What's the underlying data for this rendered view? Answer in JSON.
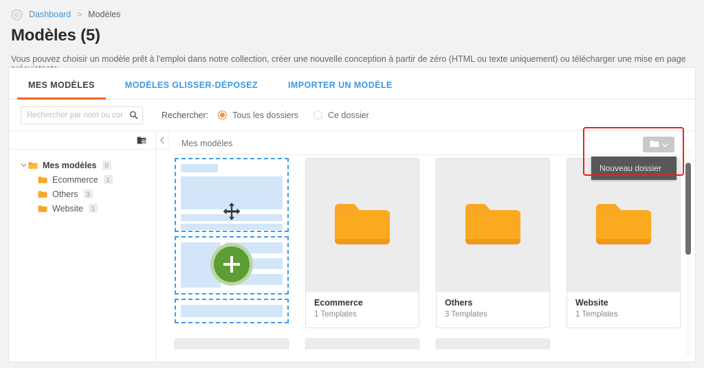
{
  "breadcrumb": {
    "icon": "gauge-icon",
    "link": "Dashboard",
    "separator": ">",
    "current": "Modèles"
  },
  "page": {
    "title": "Modèles (5)",
    "description": "Vous pouvez choisir un modèle prêt à l'emploi dans notre collection, créer une nouvelle conception à partir de zéro (HTML ou texte uniquement) ou télécharger une mise en page préexistante."
  },
  "tabs": [
    {
      "label": "MES MODÈLES",
      "active": true
    },
    {
      "label": "MODÈLES GLISSER-DÉPOSEZ",
      "active": false
    },
    {
      "label": "IMPORTER UN MODÈLE",
      "active": false
    }
  ],
  "search": {
    "placeholder": "Rechercher par nom ou contenu",
    "value": "",
    "icon": "search-icon",
    "label": "Rechercher:",
    "options": [
      {
        "label": "Tous les dossiers",
        "checked": true
      },
      {
        "label": "Ce dossier",
        "checked": false
      }
    ]
  },
  "sidebar": {
    "new_folder_icon": "folder-plus-icon",
    "tree": [
      {
        "label": "Mes modèles",
        "count": "0",
        "level": 0,
        "expanded": true
      },
      {
        "label": "Ecommerce",
        "count": "1",
        "level": 1
      },
      {
        "label": "Others",
        "count": "3",
        "level": 1
      },
      {
        "label": "Website",
        "count": "1",
        "level": 1
      }
    ]
  },
  "content": {
    "collapse_icon": "chevron-left-icon",
    "header_title": "Mes modèles",
    "dropdown": {
      "button_icon": "folder-icon",
      "chevron_icon": "chevron-down-icon",
      "menu_items": [
        {
          "label": "Nouveau dossier"
        }
      ]
    },
    "cards": [
      {
        "type": "dragdrop",
        "move_icon": "move-arrows-icon",
        "add_icon": "plus-icon"
      },
      {
        "type": "folder",
        "icon": "folder-icon",
        "title": "Ecommerce",
        "subtitle": "1 Templates"
      },
      {
        "type": "folder",
        "icon": "folder-icon",
        "title": "Others",
        "subtitle": "3 Templates"
      },
      {
        "type": "folder",
        "icon": "folder-icon",
        "title": "Website",
        "subtitle": "1 Templates"
      }
    ],
    "partial_row_count": 3
  },
  "colors": {
    "accent_orange": "#f26522",
    "link_blue": "#3e97e0",
    "folder_orange": "#f9a826",
    "green": "#5d9e34",
    "highlight_red": "#ef1d1d",
    "menu_dark": "#585858"
  }
}
